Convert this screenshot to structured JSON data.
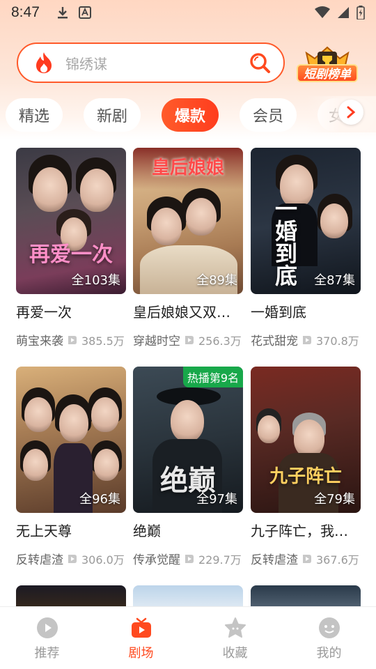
{
  "status_bar": {
    "time": "8:47",
    "icons": [
      "download-icon",
      "notification-app-icon",
      "wifi-icon",
      "signal-icon",
      "battery-icon"
    ]
  },
  "search": {
    "placeholder": "锦绣谋",
    "accent_color": "#ff5a2a"
  },
  "rank_badge": {
    "label": "短剧榜单"
  },
  "tabs": [
    {
      "label": "精选",
      "active": false
    },
    {
      "label": "新剧",
      "active": false
    },
    {
      "label": "爆款",
      "active": true
    },
    {
      "label": "会员",
      "active": false
    },
    {
      "label": "女",
      "active": false
    }
  ],
  "cards": [
    {
      "title": "再爱一次",
      "episodes": "全103集",
      "tag": "萌宝来袭",
      "views": "385.5万",
      "poster_text": "再爱一次",
      "hot": ""
    },
    {
      "title": "皇后娘娘又双胎…",
      "episodes": "全89集",
      "tag": "穿越时空",
      "views": "256.3万",
      "poster_text": "皇后娘娘",
      "hot": ""
    },
    {
      "title": "一婚到底",
      "episodes": "全87集",
      "tag": "花式甜宠",
      "views": "370.8万",
      "poster_text": "一婚到底",
      "hot": ""
    },
    {
      "title": "无上天尊",
      "episodes": "全96集",
      "tag": "反转虐渣",
      "views": "306.0万",
      "poster_text": "",
      "hot": ""
    },
    {
      "title": "绝巅",
      "episodes": "全97集",
      "tag": "传承觉醒",
      "views": "229.7万",
      "poster_text": "绝巅",
      "hot": "热播第9名"
    },
    {
      "title": "九子阵亡，我背…",
      "episodes": "全79集",
      "tag": "反转虐渣",
      "views": "367.6万",
      "poster_text": "九子阵亡",
      "hot": ""
    }
  ],
  "bottom_nav": [
    {
      "label": "推荐",
      "icon": "play-circle-icon",
      "active": false
    },
    {
      "label": "剧场",
      "icon": "tv-icon",
      "active": true
    },
    {
      "label": "收藏",
      "icon": "star-face-icon",
      "active": false
    },
    {
      "label": "我的",
      "icon": "profile-face-icon",
      "active": false
    }
  ]
}
